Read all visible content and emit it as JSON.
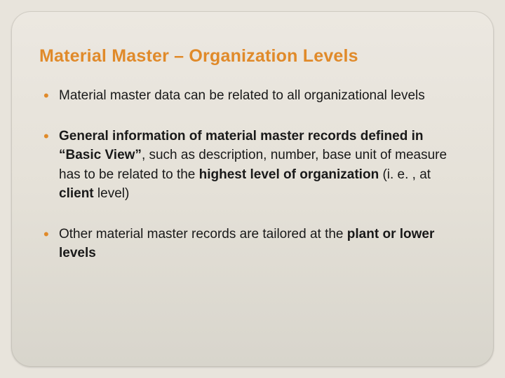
{
  "title": "Material Master – Organization Levels",
  "bullets": {
    "b1": "Material master data can be related to all organizational levels",
    "b2a": "General information of material master records defined in “Basic View”",
    "b2b": ", such as description, number, base unit of measure has to be related to the ",
    "b2c": "highest level of organization",
    "b2d": " (i. e. , at ",
    "b2e": "client",
    "b2f": " level)",
    "b3a": "Other material master records are tailored at the ",
    "b3b": "plant or lower levels"
  }
}
